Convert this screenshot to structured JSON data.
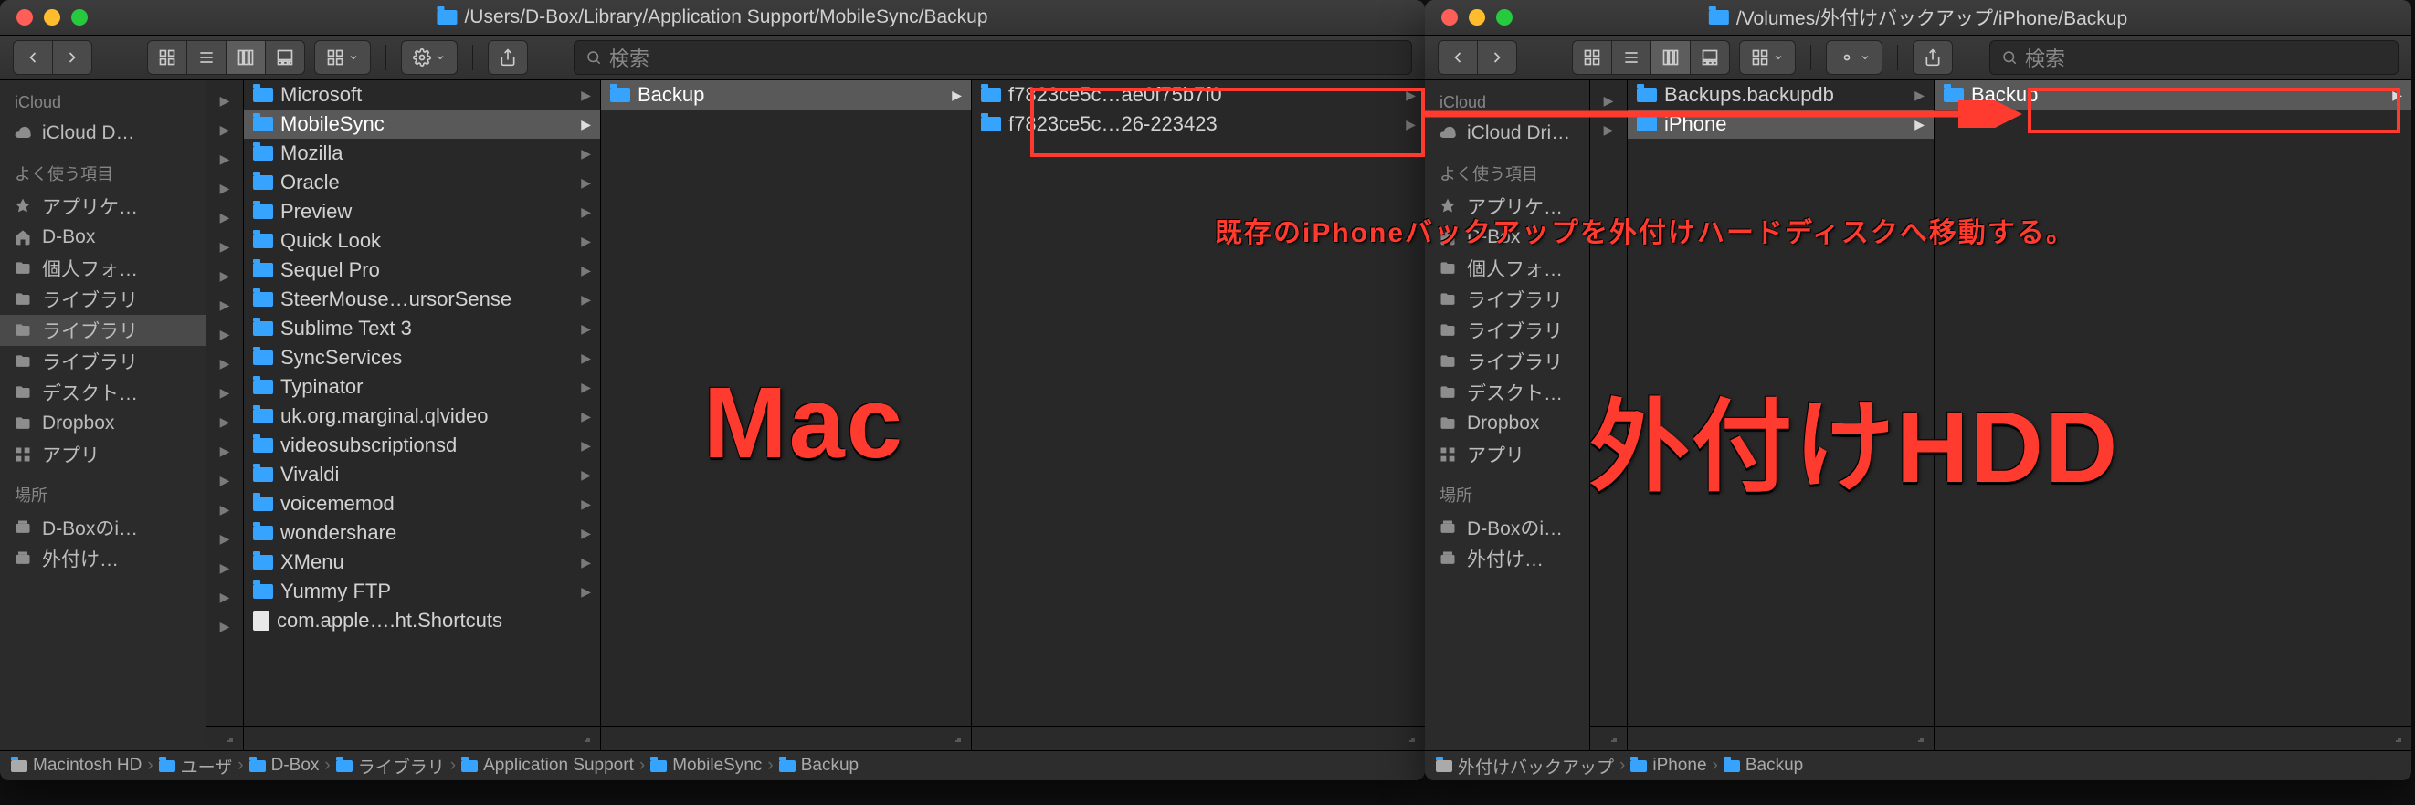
{
  "windows": {
    "left": {
      "title_path": "/Users/D-Box/Library/Application Support/MobileSync/Backup",
      "search_placeholder": "検索",
      "sidebar": {
        "groups": [
          {
            "header": "iCloud",
            "items": [
              {
                "icon": "cloud",
                "label": "iCloud D…"
              }
            ]
          },
          {
            "header": "よく使う項目",
            "items": [
              {
                "icon": "star",
                "label": "アプリケ…"
              },
              {
                "icon": "home",
                "label": "D-Box"
              },
              {
                "icon": "folder",
                "label": "個人フォ…"
              },
              {
                "icon": "folder",
                "label": "ライブラリ"
              },
              {
                "icon": "folder",
                "label": "ライブラリ",
                "selected": true
              },
              {
                "icon": "folder",
                "label": "ライブラリ"
              },
              {
                "icon": "folder",
                "label": "デスクト…"
              },
              {
                "icon": "folder",
                "label": "Dropbox"
              },
              {
                "icon": "app",
                "label": "アプリ"
              }
            ]
          },
          {
            "header": "場所",
            "items": [
              {
                "icon": "disk",
                "label": "D-Boxのi…"
              },
              {
                "icon": "disk",
                "label": "外付け…"
              }
            ]
          }
        ]
      },
      "columns": [
        {
          "type": "nav"
        },
        {
          "items": [
            {
              "label": "Microsoft",
              "type": "folder",
              "arrow": true
            },
            {
              "label": "MobileSync",
              "type": "folder",
              "arrow": true,
              "selected": true
            },
            {
              "label": "Mozilla",
              "type": "folder",
              "arrow": true
            },
            {
              "label": "Oracle",
              "type": "folder",
              "arrow": true
            },
            {
              "label": "Preview",
              "type": "folder",
              "arrow": true
            },
            {
              "label": "Quick Look",
              "type": "folder",
              "arrow": true
            },
            {
              "label": "Sequel Pro",
              "type": "folder",
              "arrow": true
            },
            {
              "label": "SteerMouse…ursorSense",
              "type": "folder",
              "arrow": true
            },
            {
              "label": "Sublime Text 3",
              "type": "folder",
              "arrow": true
            },
            {
              "label": "SyncServices",
              "type": "folder",
              "arrow": true
            },
            {
              "label": "Typinator",
              "type": "folder",
              "arrow": true
            },
            {
              "label": "uk.org.marginal.qlvideo",
              "type": "folder",
              "arrow": true
            },
            {
              "label": "videosubscriptionsd",
              "type": "folder",
              "arrow": true
            },
            {
              "label": "Vivaldi",
              "type": "folder",
              "arrow": true
            },
            {
              "label": "voicememod",
              "type": "folder",
              "arrow": true
            },
            {
              "label": "wondershare",
              "type": "folder",
              "arrow": true
            },
            {
              "label": "XMenu",
              "type": "folder",
              "arrow": true
            },
            {
              "label": "Yummy FTP",
              "type": "folder",
              "arrow": true
            },
            {
              "label": "com.apple….ht.Shortcuts",
              "type": "doc",
              "arrow": false
            }
          ]
        },
        {
          "items": [
            {
              "label": "Backup",
              "type": "folder",
              "arrow": true,
              "selected": true
            }
          ]
        },
        {
          "items": [
            {
              "label": "f7823ce5c…ae0f75b7f0",
              "type": "folder",
              "arrow": true
            },
            {
              "label": "f7823ce5c…26-223423",
              "type": "folder",
              "arrow": true
            }
          ]
        }
      ],
      "path": [
        "Macintosh HD",
        "ユーザ",
        "D-Box",
        "ライブラリ",
        "Application Support",
        "MobileSync",
        "Backup"
      ]
    },
    "right": {
      "title_path": "/Volumes/外付けバックアップ/iPhone/Backup",
      "search_placeholder": "検索",
      "sidebar": {
        "groups": [
          {
            "header": "iCloud",
            "items": [
              {
                "icon": "cloud",
                "label": "iCloud Dri…"
              }
            ]
          },
          {
            "header": "よく使う項目",
            "items": [
              {
                "icon": "star",
                "label": "アプリケ…"
              },
              {
                "icon": "home",
                "label": "D-Box"
              },
              {
                "icon": "folder",
                "label": "個人フォ…"
              },
              {
                "icon": "folder",
                "label": "ライブラリ"
              },
              {
                "icon": "folder",
                "label": "ライブラリ"
              },
              {
                "icon": "folder",
                "label": "ライブラリ"
              },
              {
                "icon": "folder",
                "label": "デスクト…"
              },
              {
                "icon": "folder",
                "label": "Dropbox"
              },
              {
                "icon": "app",
                "label": "アプリ"
              }
            ]
          },
          {
            "header": "場所",
            "items": [
              {
                "icon": "disk",
                "label": "D-Boxのi…"
              },
              {
                "icon": "disk",
                "label": "外付け…"
              }
            ]
          }
        ]
      },
      "columns": [
        {
          "type": "nav"
        },
        {
          "items": [
            {
              "label": "Backups.backupdb",
              "type": "folder",
              "arrow": true
            },
            {
              "label": "iPhone",
              "type": "folder",
              "arrow": true,
              "selected": true
            }
          ]
        },
        {
          "items": [
            {
              "label": "Backup",
              "type": "folder",
              "arrow": true,
              "selected": true
            }
          ]
        }
      ],
      "path": [
        "外付けバックアップ",
        "iPhone",
        "Backup"
      ]
    }
  },
  "annotations": {
    "mac": "Mac",
    "hdd": "外付けHDD",
    "note": "既存のiPhoneバックアップを外付けハードディスクへ移動する。"
  }
}
